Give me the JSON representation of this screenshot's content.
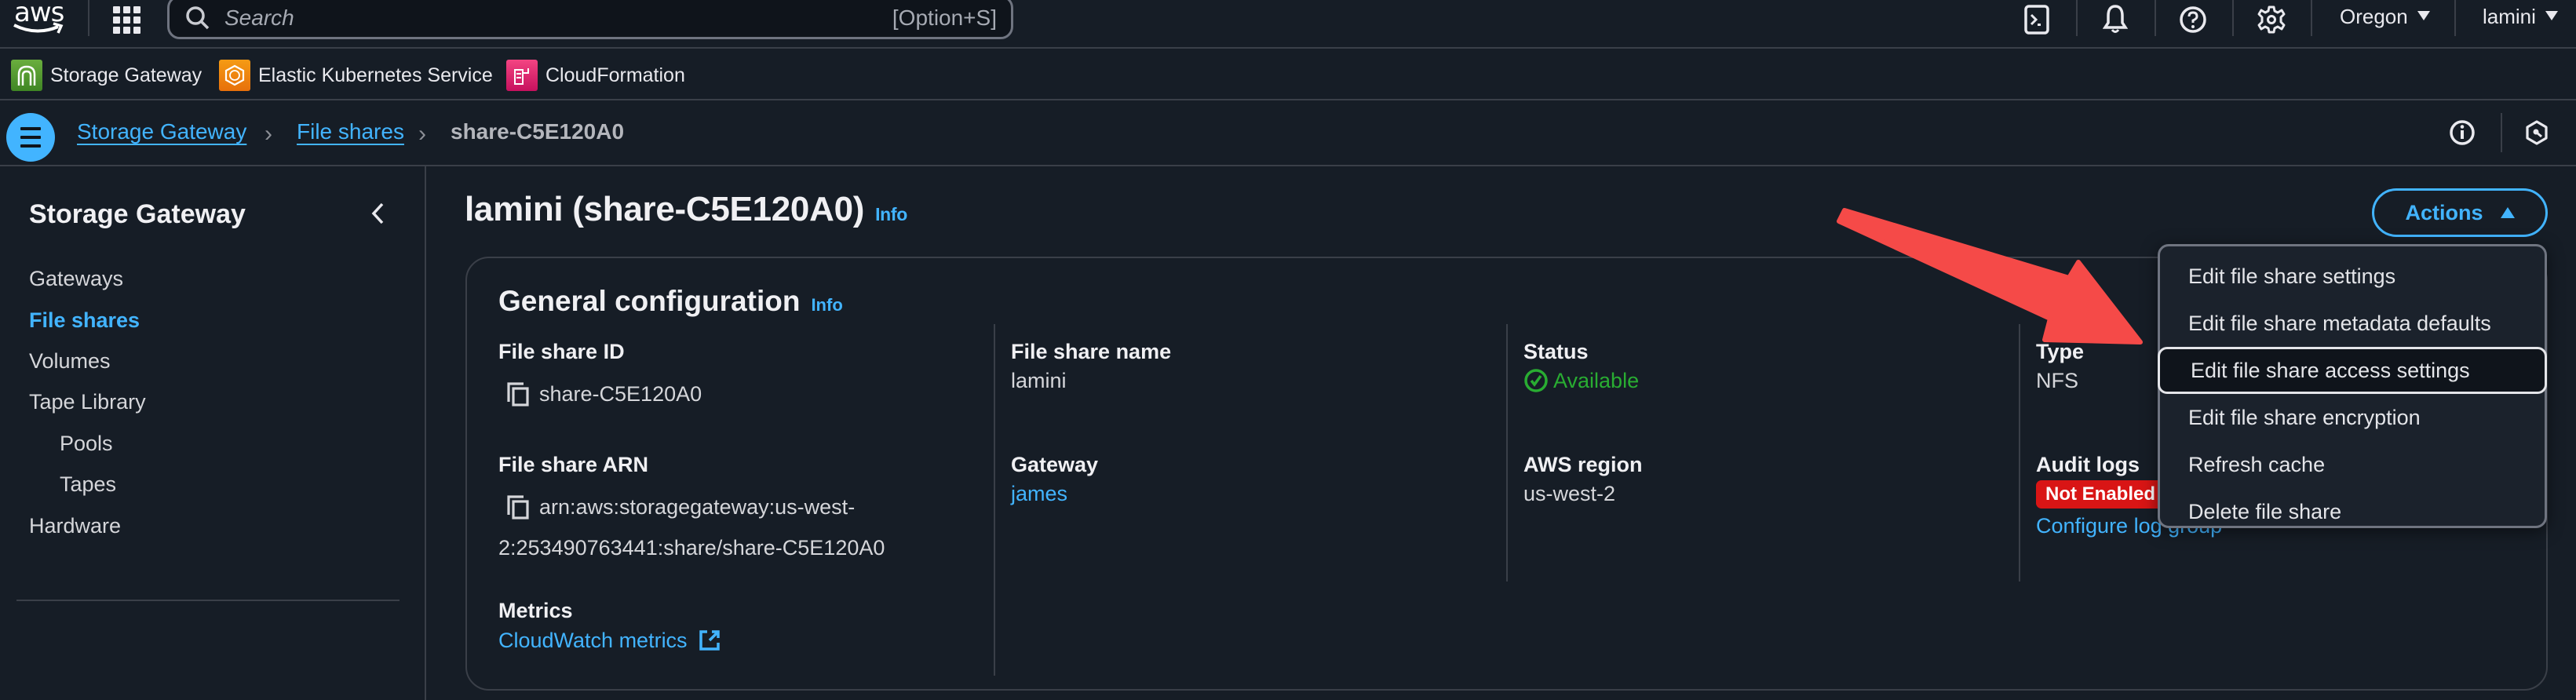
{
  "topnav": {
    "logo": "aws",
    "search_placeholder": "Search",
    "search_shortcut": "[Option+S]",
    "icons": [
      "cloudshell-icon",
      "bell-icon",
      "help-icon",
      "gear-icon"
    ],
    "region": "Oregon",
    "user": "lamini"
  },
  "favorites": [
    {
      "label": "Storage Gateway",
      "color": "#3f8624"
    },
    {
      "label": "Elastic Kubernetes Service",
      "color": "#e7700b"
    },
    {
      "label": "CloudFormation",
      "color": "#e7157b"
    }
  ],
  "breadcrumb": {
    "items": [
      "Storage Gateway",
      "File shares"
    ],
    "current": "share-C5E120A0"
  },
  "sidebar": {
    "title": "Storage Gateway",
    "items": [
      {
        "label": "Gateways",
        "active": false,
        "sub": false
      },
      {
        "label": "File shares",
        "active": true,
        "sub": false
      },
      {
        "label": "Volumes",
        "active": false,
        "sub": false
      },
      {
        "label": "Tape Library",
        "active": false,
        "sub": false
      },
      {
        "label": "Pools",
        "active": false,
        "sub": true
      },
      {
        "label": "Tapes",
        "active": false,
        "sub": true
      },
      {
        "label": "Hardware",
        "active": false,
        "sub": false
      }
    ]
  },
  "page": {
    "title": "lamini (share-C5E120A0)",
    "info": "Info",
    "actions_label": "Actions"
  },
  "general": {
    "title": "General configuration",
    "info": "Info",
    "file_share_id_label": "File share ID",
    "file_share_id": "share-C5E120A0",
    "file_share_arn_label": "File share ARN",
    "file_share_arn_line1": "arn:aws:storagegateway:us-west-",
    "file_share_arn_line2": "2:253490763441:share/share-C5E120A0",
    "metrics_label": "Metrics",
    "metrics_link": "CloudWatch metrics",
    "file_share_name_label": "File share name",
    "file_share_name": "lamini",
    "gateway_label": "Gateway",
    "gateway": "james",
    "status_label": "Status",
    "status": "Available",
    "region_label": "AWS region",
    "region": "us-west-2",
    "type_label": "Type",
    "type": "NFS",
    "audit_logs_label": "Audit logs",
    "audit_logs_badge": "Not Enabled",
    "audit_logs_link": "Configure log group"
  },
  "actions_menu": {
    "items": [
      "Edit file share settings",
      "Edit file share metadata defaults",
      "Edit file share access settings",
      "Edit file share encryption",
      "Refresh cache",
      "Delete file share"
    ],
    "focused_index": 2
  },
  "colors": {
    "accent": "#42b4ff",
    "background": "#161d26",
    "status_ok": "#29ad32",
    "badge_error": "#d91515",
    "annotation_arrow": "#f54a48"
  }
}
